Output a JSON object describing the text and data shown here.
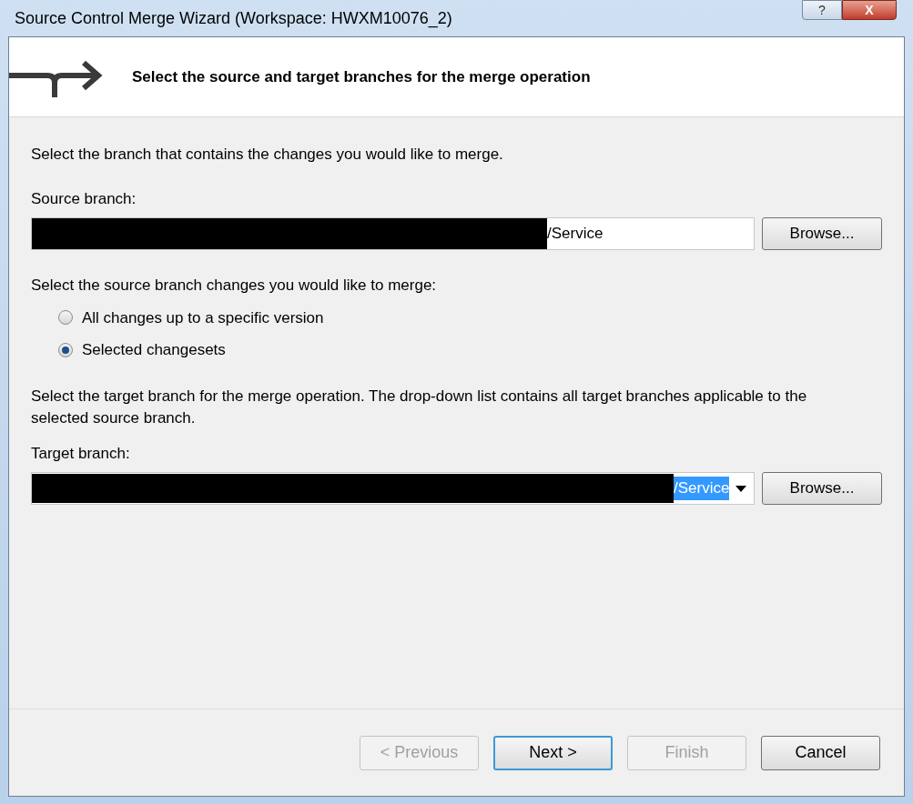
{
  "window": {
    "title": "Source Control Merge Wizard (Workspace: HWXM10076_2)",
    "help_button": "?",
    "close_button": "X"
  },
  "header": {
    "title": "Select the source and target branches for the merge operation"
  },
  "intro": "Select the branch that contains the changes you would like to merge.",
  "source": {
    "label": "Source branch:",
    "value": "/Service",
    "redacted": true,
    "browse": "Browse..."
  },
  "changes": {
    "label": "Select the source branch changes you would like to merge:",
    "options": [
      {
        "label": "All changes up to a specific version",
        "selected": false
      },
      {
        "label": "Selected changesets",
        "selected": true
      }
    ]
  },
  "target": {
    "description": "Select the target branch for the merge operation.  The drop-down list contains all target branches applicable to the selected source branch.",
    "label": "Target branch:",
    "value": "/Service",
    "redacted": true,
    "text_selected": true,
    "browse": "Browse..."
  },
  "buttons": [
    {
      "label": "< Previous",
      "disabled": true,
      "default": false
    },
    {
      "label": "Next >",
      "disabled": false,
      "default": true
    },
    {
      "label": "Finish",
      "disabled": true,
      "default": false
    },
    {
      "label": "Cancel",
      "disabled": false,
      "default": false
    }
  ]
}
